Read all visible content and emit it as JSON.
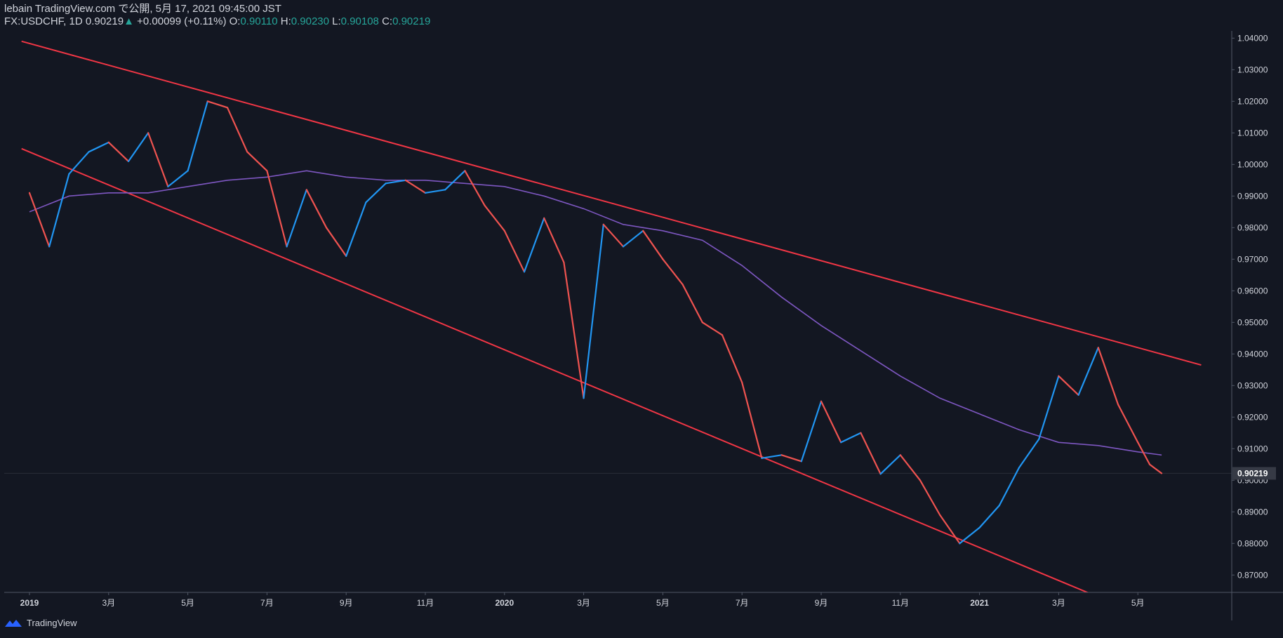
{
  "header": {
    "publisher_line": "lebain TradingView.com で公開, 5月 17, 2021 09:45:00 JST",
    "symbol": "FX:USDCHF, 1D",
    "price": "0.90219",
    "change_arrow": "▲",
    "change": "+0.00099 (+0.11%)",
    "open_label": "O:",
    "open": "0.90110",
    "high_label": "H:",
    "high": "0.90230",
    "low_label": "L:",
    "low": "0.90108",
    "close_label": "C:",
    "close": "0.90219"
  },
  "footer": {
    "brand": "TradingView"
  },
  "chart_data": {
    "type": "line",
    "symbol": "USDCHF",
    "ylim": [
      0.8645,
      1.0423
    ],
    "y_ticks": [
      "1.04000",
      "1.03000",
      "1.02000",
      "1.01000",
      "1.00000",
      "0.99000",
      "0.98000",
      "0.97000",
      "0.96000",
      "0.95000",
      "0.94000",
      "0.93000",
      "0.92000",
      "0.91000",
      "0.90000",
      "0.89000",
      "0.88000",
      "0.87000"
    ],
    "x_ticks": [
      "2019",
      "3月",
      "5月",
      "7月",
      "9月",
      "11月",
      "2020",
      "3月",
      "5月",
      "7月",
      "9月",
      "11月",
      "2021",
      "3月",
      "5月"
    ],
    "x_tick_months": [
      0,
      2,
      4,
      6,
      8,
      10,
      12,
      14,
      16,
      18,
      20,
      22,
      24,
      26,
      28
    ],
    "last_price": "0.90219",
    "last_price_value": 0.90219,
    "price_series": {
      "name": "",
      "months": [
        0,
        0.5,
        1,
        1.5,
        2,
        2.5,
        3,
        3.5,
        4,
        4.5,
        5,
        5.5,
        6,
        6.5,
        7,
        7.5,
        8,
        8.5,
        9,
        9.5,
        10,
        10.5,
        11,
        11.5,
        12,
        12.5,
        13,
        13.5,
        14,
        14.5,
        15,
        15.5,
        16,
        16.5,
        17,
        17.5,
        18,
        18.5,
        19,
        19.5,
        20,
        20.5,
        21,
        21.5,
        22,
        22.5,
        23,
        23.5,
        24,
        24.5,
        25,
        25.5,
        26,
        26.5,
        27,
        27.5,
        28,
        28.3,
        28.6
      ],
      "values": [
        0.991,
        0.974,
        0.997,
        1.004,
        1.007,
        1.001,
        1.01,
        0.993,
        0.998,
        1.02,
        1.018,
        1.004,
        0.998,
        0.974,
        0.992,
        0.98,
        0.971,
        0.988,
        0.994,
        0.995,
        0.991,
        0.992,
        0.998,
        0.987,
        0.979,
        0.966,
        0.983,
        0.969,
        0.926,
        0.981,
        0.974,
        0.979,
        0.97,
        0.962,
        0.95,
        0.946,
        0.931,
        0.907,
        0.908,
        0.906,
        0.925,
        0.912,
        0.915,
        0.902,
        0.908,
        0.9,
        0.889,
        0.88,
        0.885,
        0.892,
        0.904,
        0.913,
        0.933,
        0.927,
        0.942,
        0.924,
        0.912,
        0.905,
        0.9022
      ]
    },
    "moving_average": {
      "name": "",
      "months": [
        0,
        1,
        2,
        3,
        4,
        5,
        6,
        7,
        8,
        9,
        10,
        11,
        12,
        13,
        14,
        15,
        16,
        17,
        18,
        19,
        20,
        21,
        22,
        23,
        24,
        25,
        26,
        27,
        28,
        28.6
      ],
      "values": [
        0.985,
        0.99,
        0.991,
        0.991,
        0.993,
        0.995,
        0.996,
        0.998,
        0.996,
        0.995,
        0.995,
        0.994,
        0.993,
        0.99,
        0.986,
        0.981,
        0.979,
        0.976,
        0.968,
        0.958,
        0.949,
        0.941,
        0.933,
        0.926,
        0.921,
        0.916,
        0.912,
        0.911,
        0.909,
        0.908
      ]
    },
    "trendlines": [
      {
        "from": [
          -0.2,
          1.039
        ],
        "to": [
          29.6,
          0.9365
        ]
      },
      {
        "from": [
          -0.2,
          1.005
        ],
        "to": [
          27.2,
          0.862
        ]
      }
    ],
    "colors": {
      "background": "#131722",
      "up": "#2196f3",
      "down": "#ef5350",
      "moving_average": "#7e57c2",
      "trendline": "#f23645",
      "axis_text": "#d1d4dc",
      "axis_line": "#505765"
    }
  }
}
